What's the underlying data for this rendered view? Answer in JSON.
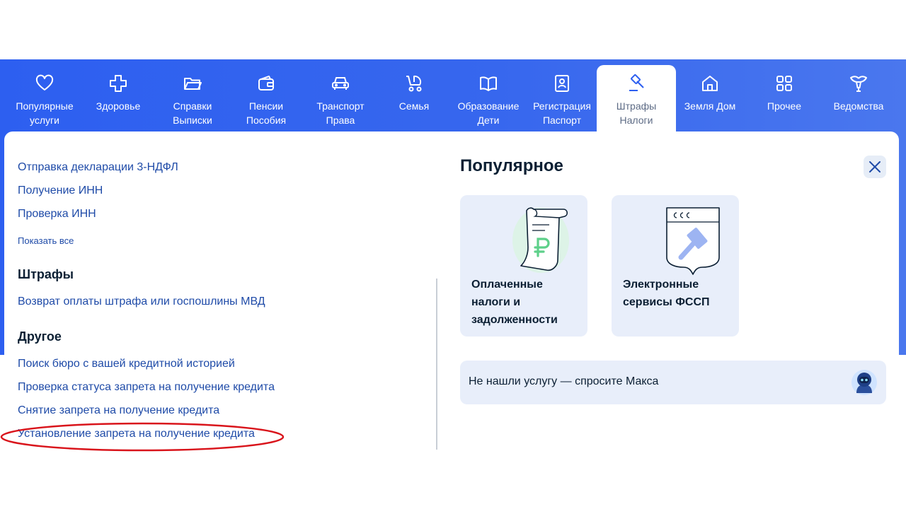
{
  "nav": {
    "items": [
      {
        "label": "Популярные\nуслуги",
        "icon": "heart-icon"
      },
      {
        "label": "Здоровье",
        "icon": "medical-cross-icon"
      },
      {
        "label": "Справки\nВыписки",
        "icon": "folder-icon"
      },
      {
        "label": "Пенсии\nПособия",
        "icon": "wallet-icon"
      },
      {
        "label": "Транспорт\nПрава",
        "icon": "car-icon"
      },
      {
        "label": "Семья",
        "icon": "stroller-icon"
      },
      {
        "label": "Образование\nДети",
        "icon": "book-icon"
      },
      {
        "label": "Регистрация\nПаспорт",
        "icon": "passport-icon"
      },
      {
        "label": "Штрафы\nНалоги",
        "icon": "gavel-icon",
        "active": true
      },
      {
        "label": "Земля Дом",
        "icon": "house-icon"
      },
      {
        "label": "Прочее",
        "icon": "grid-icon"
      },
      {
        "label": "Ведомства",
        "icon": "emblem-icon"
      }
    ]
  },
  "left": {
    "tax_links": [
      "Отправка декларации 3-НДФЛ",
      "Получение ИНН",
      "Проверка ИНН"
    ],
    "show_all": "Показать все",
    "fines": {
      "heading": "Штрафы",
      "links": [
        "Возврат оплаты штрафа или госпошлины МВД"
      ]
    },
    "other": {
      "heading": "Другое",
      "links": [
        "Поиск бюро с вашей кредитной историей",
        "Проверка статуса запрета на получение кредита",
        "Снятие запрета на получение кредита",
        "Установление запрета на получение кредита"
      ]
    }
  },
  "popular": {
    "title": "Популярное",
    "cards": [
      {
        "label": "Оплаченные налоги и задолженности",
        "icon": "receipt-ruble-icon"
      },
      {
        "label": "Электронные сервисы ФССП",
        "icon": "fssp-shield-icon"
      }
    ],
    "ask": "Не нашли услугу — спросите Макса",
    "ask_icon": "robot-assistant-icon"
  },
  "colors": {
    "brand_blue": "#2d5ff0",
    "link": "#1f4ba8",
    "card_bg": "#e8eefa",
    "annotation_red": "#d9141b"
  }
}
